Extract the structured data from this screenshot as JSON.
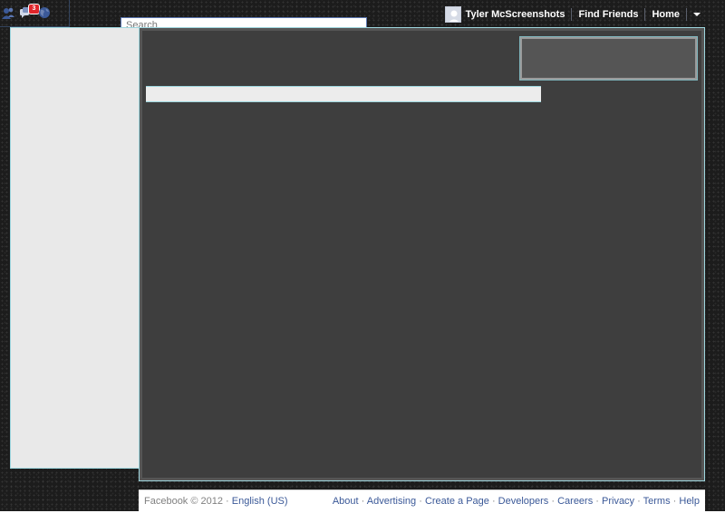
{
  "topbar": {
    "notifications_badge": "3",
    "search_placeholder": "Search",
    "user_name": "Tyler McScreenshots",
    "find_friends": "Find Friends",
    "home": "Home",
    "icons": [
      "friend-requests-icon",
      "messages-icon",
      "notifications-globe-icon",
      "dropdown-caret-icon"
    ]
  },
  "footer": {
    "copyright": "Facebook © 2012 ·",
    "language": "English (US)",
    "links": [
      "About",
      "Advertising",
      "Create a Page",
      "Developers",
      "Careers",
      "Privacy",
      "Terms",
      "Help"
    ]
  },
  "colors": {
    "link_blue": "#3b5998",
    "badge_red": "#e0262b",
    "panel_outline": "#9ed6de"
  }
}
